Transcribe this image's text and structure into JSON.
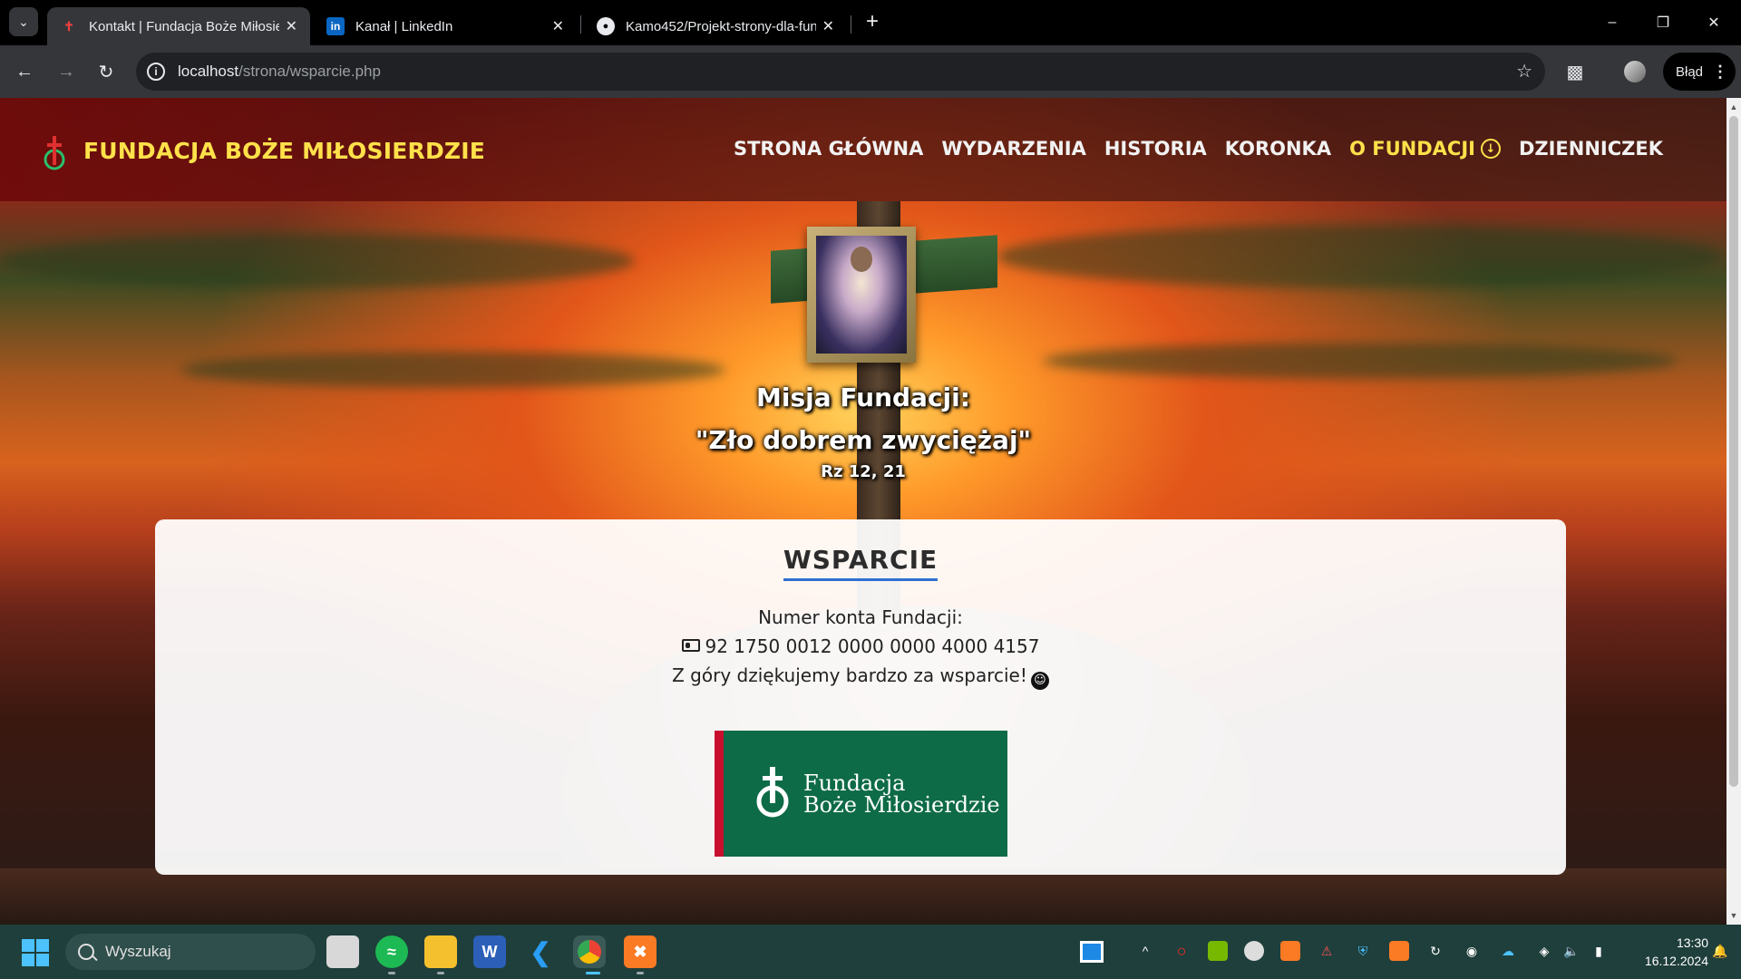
{
  "browser": {
    "tabs": [
      {
        "title": "Kontakt | Fundacja Boże Miłosierdzie",
        "favicon": "cross-icon",
        "active": true
      },
      {
        "title": "Kanał | LinkedIn",
        "favicon": "linkedin-icon",
        "active": false
      },
      {
        "title": "Kamo452/Projekt-strony-dla-fundacji",
        "favicon": "github-icon",
        "active": false
      }
    ],
    "url_host": "localhost",
    "url_path": "/strona/wsparcie.php",
    "profile_label": "Błąd"
  },
  "site": {
    "brand": "FUNDACJA BOŻE MIŁOSIERDZIE",
    "nav": [
      "STRONA GŁÓWNA",
      "WYDARZENIA",
      "HISTORIA",
      "KORONKA",
      "O FUNDACJI",
      "DZIENNICZEK"
    ],
    "active_nav": "O FUNDACJI",
    "mission_title": "Misja Fundacji:",
    "mission_quote": "\"Zło dobrem zwyciężaj\"",
    "mission_ref": "Rz 12, 21",
    "section_title": "WSPARCIE",
    "account_label": "Numer konta Fundacji:",
    "account_number": "92 1750 0012 0000 0000 4000 4157",
    "thanks": "Z góry dziękujemy bardzo za wsparcie!",
    "logo_line1": "Fundacja",
    "logo_line2": "Boże Miłosierdzie"
  },
  "taskbar": {
    "search_placeholder": "Wyszukaj",
    "time": "13:30",
    "date": "16.12.2024"
  },
  "colors": {
    "brand_yellow": "#ffe14a",
    "logo_green": "#0e6b47",
    "logo_red": "#c8102e",
    "title_underline": "#2e6fd0"
  }
}
